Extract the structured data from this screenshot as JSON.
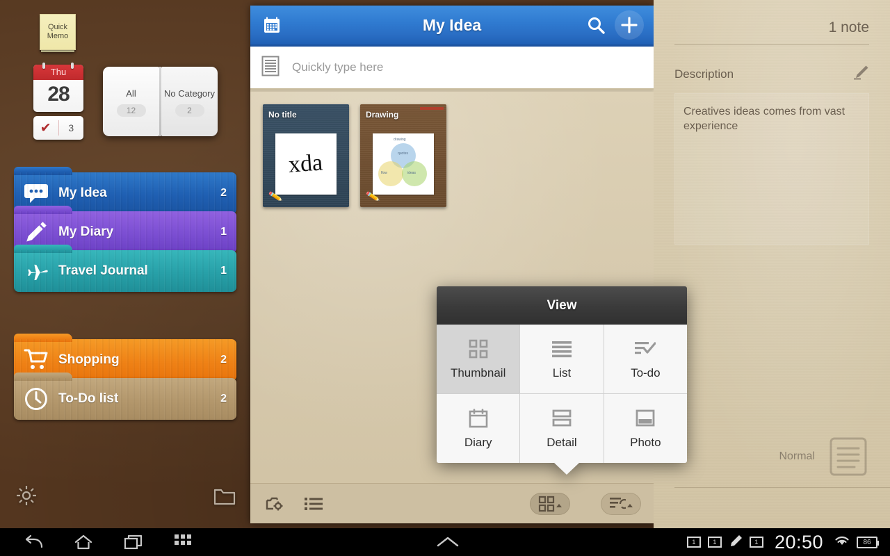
{
  "desktop": {
    "quick_memo": {
      "line1": "Quick",
      "line2": "Memo"
    },
    "calendar": {
      "weekday": "Thu",
      "day": "28",
      "task_count": "3",
      "check_glyph": "✔"
    },
    "book_widget": {
      "left": {
        "label": "All",
        "count": "12"
      },
      "right": {
        "label": "No Category",
        "count": "2"
      }
    },
    "folders_primary": [
      {
        "name": "My Idea",
        "count": "2",
        "icon": "speech-bubble-icon",
        "color": "#1f63b8"
      },
      {
        "name": "My Diary",
        "count": "1",
        "icon": "pencil-icon",
        "color": "#7b4ed2"
      },
      {
        "name": "Travel Journal",
        "count": "1",
        "icon": "airplane-icon",
        "color": "#2aa6ad"
      }
    ],
    "folders_secondary": [
      {
        "name": "Shopping",
        "count": "2",
        "icon": "shopping-cart-icon",
        "color": "#f08a1c"
      },
      {
        "name": "To-Do list",
        "count": "2",
        "icon": "clock-icon",
        "color": "#b79a70"
      }
    ],
    "shortcuts": [
      {
        "name": "settings-shortcut",
        "icon": "gear-icon"
      },
      {
        "name": "folder-shortcut",
        "icon": "folder-icon"
      }
    ]
  },
  "app": {
    "title": "My Idea",
    "calendar_icon": "calendar-icon",
    "search_icon": "search-icon",
    "add_label": "+",
    "quick_type": {
      "placeholder": "Quickly type here",
      "icon": "note-lines-icon"
    },
    "notes": [
      {
        "title": "No title",
        "theme": "navy",
        "preview_text": "xda",
        "preview_kind": "handwriting",
        "has_red_tag": false
      },
      {
        "title": "Drawing",
        "theme": "cork",
        "preview_text": "",
        "preview_kind": "venn",
        "has_red_tag": true
      }
    ],
    "toolbar": {
      "camera_settings_icon": "camera-settings-icon",
      "list_icon": "bullet-list-icon",
      "view_mode_icon": "grid-view-icon",
      "sort_icon": "sort-icon"
    }
  },
  "view_popup": {
    "title": "View",
    "selected": "Thumbnail",
    "items": [
      {
        "label": "Thumbnail",
        "icon": "grid-2x2-icon",
        "selected": true
      },
      {
        "label": "List",
        "icon": "list-lines-icon",
        "selected": false
      },
      {
        "label": "To-do",
        "icon": "todo-check-icon",
        "selected": false
      },
      {
        "label": "Diary",
        "icon": "calendar-box-icon",
        "selected": false
      },
      {
        "label": "Detail",
        "icon": "detail-rows-icon",
        "selected": false
      },
      {
        "label": "Photo",
        "icon": "photo-frame-icon",
        "selected": false
      }
    ]
  },
  "detail_panel": {
    "note_count": "1 note",
    "description_label": "Description",
    "description_text": "Creatives ideas comes from vast experience",
    "edit_icon": "pencil-edit-icon",
    "priority_label": "Normal",
    "priority_icon": "note-lines-icon"
  },
  "system_bar": {
    "back_icon": "back-icon",
    "home_icon": "home-icon",
    "recents_icon": "recents-icon",
    "apps_icon": "apps-grid-icon",
    "up_icon": "chevron-up-icon",
    "notifications": [
      {
        "icon": "notification-badge-icon",
        "value": "1"
      },
      {
        "icon": "notification-badge-icon",
        "value": "1"
      },
      {
        "icon": "pencil-icon",
        "value": ""
      },
      {
        "icon": "notification-badge-icon",
        "value": "1"
      }
    ],
    "clock": "20:50",
    "wifi_icon": "wifi-icon",
    "battery_level": "86"
  }
}
